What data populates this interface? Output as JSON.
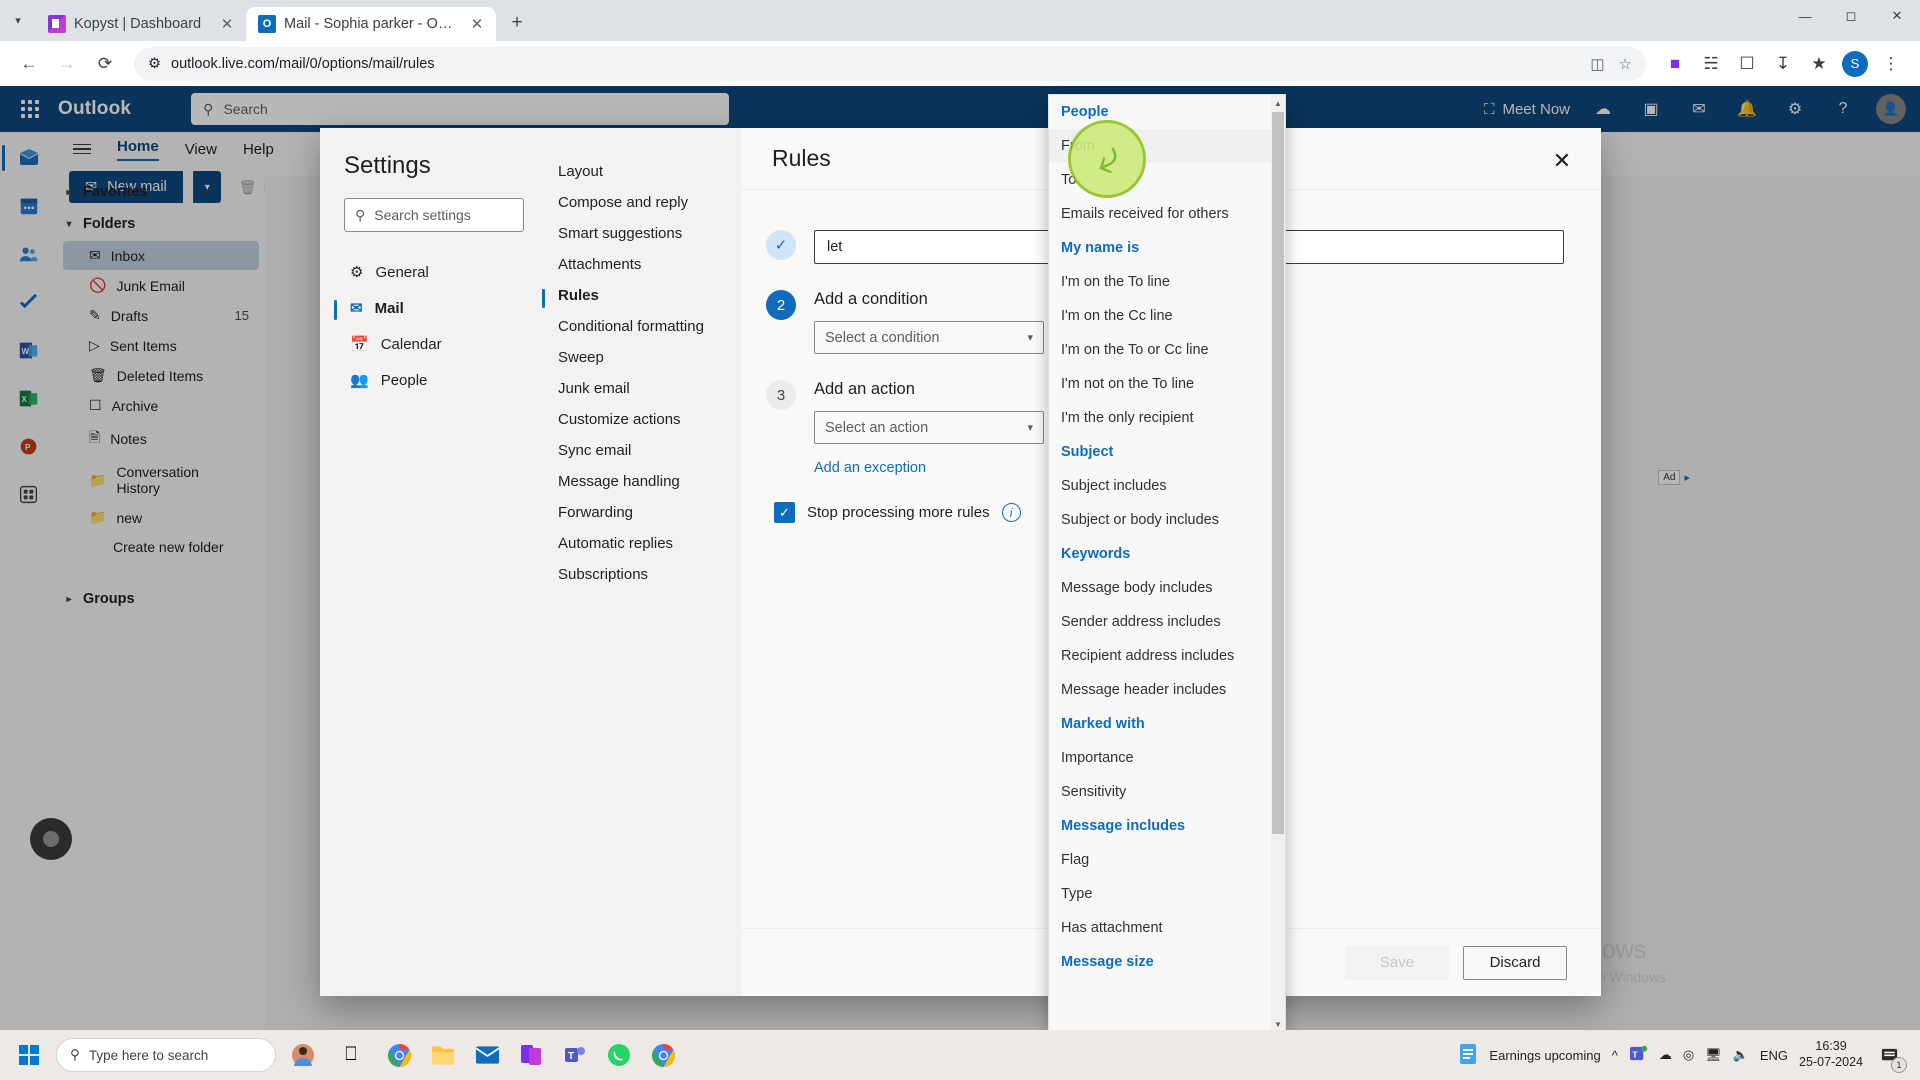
{
  "browser": {
    "tabs": [
      {
        "title": "Kopyst | Dashboard",
        "active": false,
        "favicon": "kopyst-icon"
      },
      {
        "title": "Mail - Sophia parker - Outlook",
        "active": true,
        "favicon": "outlook-icon"
      }
    ],
    "new_tab_label": "+",
    "url": "outlook.live.com/mail/0/options/mail/rules",
    "window_controls": {
      "minimize": "—",
      "maximize": "☐",
      "close": "✕"
    },
    "profile_initial": "S"
  },
  "outlook": {
    "brand": "Outlook",
    "search_placeholder": "Search",
    "meet_now": "Meet Now",
    "ribbon_tabs": [
      "Home",
      "View",
      "Help"
    ],
    "new_mail": "New mail",
    "delete_label": "Delete",
    "folder_pane": {
      "favorites": "Favorites",
      "folders": "Folders",
      "items": [
        {
          "label": "Inbox",
          "icon": "inbox-icon",
          "count": "",
          "selected": true
        },
        {
          "label": "Junk Email",
          "icon": "junk-icon",
          "count": "",
          "selected": false
        },
        {
          "label": "Drafts",
          "icon": "drafts-icon",
          "count": "15",
          "selected": false
        },
        {
          "label": "Sent Items",
          "icon": "sent-icon",
          "count": "",
          "selected": false
        },
        {
          "label": "Deleted Items",
          "icon": "trash-icon",
          "count": "",
          "selected": false
        },
        {
          "label": "Archive",
          "icon": "archive-icon",
          "count": "",
          "selected": false
        },
        {
          "label": "Notes",
          "icon": "notes-icon",
          "count": "",
          "selected": false
        },
        {
          "label": "Conversation History",
          "icon": "folder-icon",
          "count": "",
          "selected": false
        },
        {
          "label": "new",
          "icon": "folder-icon",
          "count": "",
          "selected": false
        }
      ],
      "create_new_folder": "Create new folder",
      "groups": "Groups"
    },
    "ad_label": "Ad"
  },
  "settings": {
    "title": "Settings",
    "search_placeholder": "Search settings",
    "categories": [
      {
        "label": "General",
        "icon": "gear-icon",
        "selected": false
      },
      {
        "label": "Mail",
        "icon": "mail-icon",
        "selected": true
      },
      {
        "label": "Calendar",
        "icon": "calendar-icon",
        "selected": false
      },
      {
        "label": "People",
        "icon": "people-icon",
        "selected": false
      }
    ],
    "subnav": [
      {
        "label": "Layout",
        "selected": false
      },
      {
        "label": "Compose and reply",
        "selected": false
      },
      {
        "label": "Smart suggestions",
        "selected": false
      },
      {
        "label": "Attachments",
        "selected": false
      },
      {
        "label": "Rules",
        "selected": true
      },
      {
        "label": "Conditional formatting",
        "selected": false
      },
      {
        "label": "Sweep",
        "selected": false
      },
      {
        "label": "Junk email",
        "selected": false
      },
      {
        "label": "Customize actions",
        "selected": false
      },
      {
        "label": "Sync email",
        "selected": false
      },
      {
        "label": "Message handling",
        "selected": false
      },
      {
        "label": "Forwarding",
        "selected": false
      },
      {
        "label": "Automatic replies",
        "selected": false
      },
      {
        "label": "Subscriptions",
        "selected": false
      }
    ],
    "pane_title": "Rules",
    "close_label": "✕",
    "steps": [
      {
        "badge": "✓",
        "state": "done",
        "label": "",
        "value": "let",
        "kind": "text"
      },
      {
        "badge": "2",
        "state": "active",
        "label": "Add a condition",
        "value": "Select a condition",
        "kind": "select"
      },
      {
        "badge": "3",
        "state": "idle",
        "label": "Add an action",
        "value": "Select an action",
        "kind": "select"
      }
    ],
    "add_exception": "Add an exception",
    "stop_processing": "Stop processing more rules",
    "stop_processing_checked": true,
    "info_glyph": "i",
    "save_label": "Save",
    "discard_label": "Discard"
  },
  "condition_dropdown": {
    "groups": [
      {
        "header": "People",
        "items": [
          {
            "label": "From",
            "highlighted": true
          },
          {
            "label": "To",
            "highlighted": false
          },
          {
            "label": "Emails received for others",
            "highlighted": false
          }
        ]
      },
      {
        "header": "My name is",
        "items": [
          {
            "label": "I'm on the To line",
            "highlighted": false
          },
          {
            "label": "I'm on the Cc line",
            "highlighted": false
          },
          {
            "label": "I'm on the To or Cc line",
            "highlighted": false
          },
          {
            "label": "I'm not on the To line",
            "highlighted": false
          },
          {
            "label": "I'm the only recipient",
            "highlighted": false
          }
        ]
      },
      {
        "header": "Subject",
        "items": [
          {
            "label": "Subject includes",
            "highlighted": false
          },
          {
            "label": "Subject or body includes",
            "highlighted": false
          }
        ]
      },
      {
        "header": "Keywords",
        "items": [
          {
            "label": "Message body includes",
            "highlighted": false
          },
          {
            "label": "Sender address includes",
            "highlighted": false
          },
          {
            "label": "Recipient address includes",
            "highlighted": false
          },
          {
            "label": "Message header includes",
            "highlighted": false
          }
        ]
      },
      {
        "header": "Marked with",
        "items": [
          {
            "label": "Importance",
            "highlighted": false
          },
          {
            "label": "Sensitivity",
            "highlighted": false
          }
        ]
      },
      {
        "header": "Message includes",
        "items": [
          {
            "label": "Flag",
            "highlighted": false
          },
          {
            "label": "Type",
            "highlighted": false
          },
          {
            "label": "Has attachment",
            "highlighted": false
          }
        ]
      },
      {
        "header": "Message size",
        "items": []
      }
    ]
  },
  "watermark": {
    "line1": "Activate Windows",
    "line2": "Go to Settings to activate Windows."
  },
  "taskbar": {
    "search_placeholder": "Type here to search",
    "notification_title": "Earnings upcoming",
    "language": "ENG",
    "time": "16:39",
    "date": "25-07-2024",
    "notification_count": "1"
  },
  "colors": {
    "outlook_header": "#0f4880",
    "accent_blue": "#0f6cbd",
    "cursor_green": "#8fc31f"
  }
}
